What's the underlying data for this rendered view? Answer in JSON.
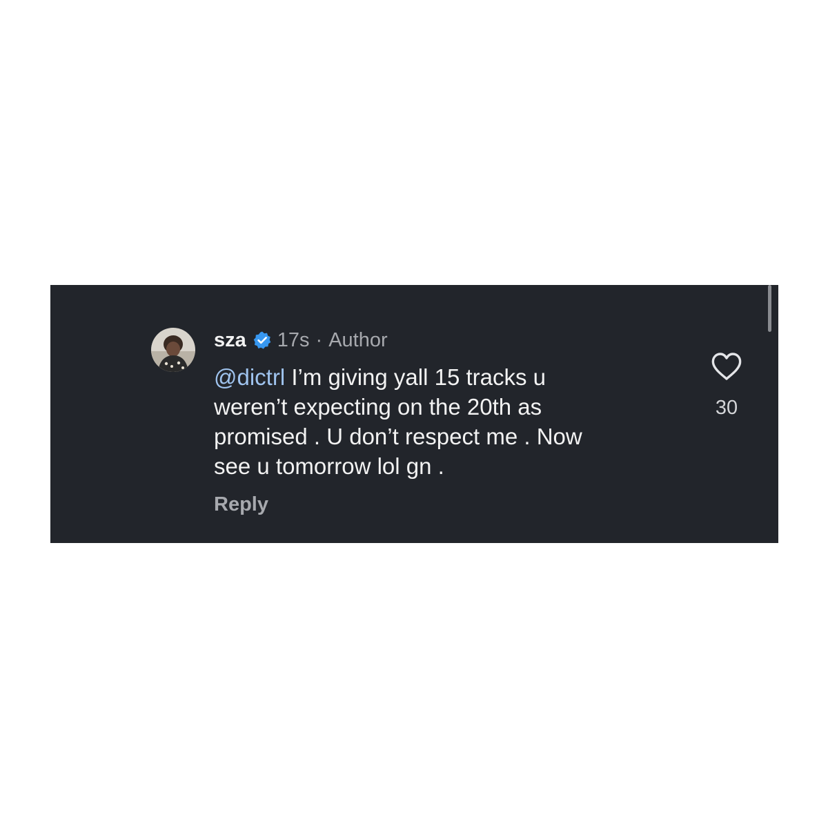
{
  "comment": {
    "username": "sza",
    "verified_icon": "verified-badge-icon",
    "time": "17s",
    "separator": "·",
    "role": "Author",
    "mention": "@dictrl",
    "text_lines": [
      " I’m giving yall 15 tracks u",
      "weren’t expecting on the 20th as",
      "promised . U don’t respect me . Now",
      "see u tomorrow lol gn ."
    ],
    "reply_label": "Reply",
    "like_icon": "heart-icon",
    "like_count": "30"
  },
  "colors": {
    "panel_background": "#22252b",
    "verified_blue": "#3797f0",
    "mention": "#9fc3ee",
    "secondary_text": "#a7a9ae"
  }
}
